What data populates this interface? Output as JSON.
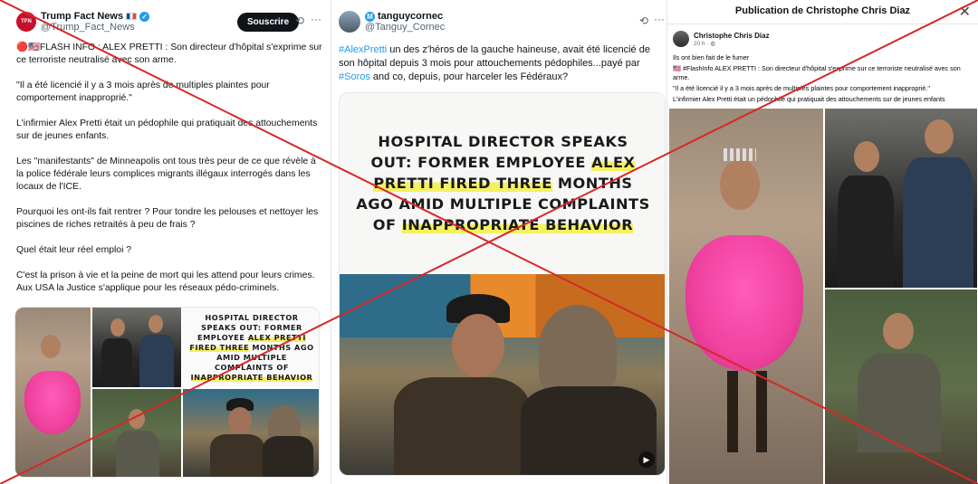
{
  "post1": {
    "account_name": "Trump Fact News",
    "account_handle": "@Trump_Fact_News",
    "avatar_text": "TFN",
    "subscribe_label": "Souscrire",
    "paragraphs": [
      "🔴🇺🇸FLASH INFO : ALEX PRETTI : Son directeur d'hôpital s'exprime sur ce terroriste neutralisé avec son arme.",
      "\"Il a été licencié il y a 3 mois après de multiples plaintes pour comportement inapproprié.\"",
      "L'infirmier Alex Pretti était un pédophile qui pratiquait des attouchements sur de jeunes enfants.",
      "Les \"manifestants\" de Minneapolis ont tous très peur de ce que révèle à la police fédérale leurs complices migrants illégaux interrogés dans les locaux de l'ICE.",
      "Pourquoi les ont-ils fait rentrer ? Pour tondre les pelouses et nettoyer les piscines de riches retraités à peu de frais ?",
      "Quel était leur réel emploi ?",
      "C'est la prison à vie et la peine de mort qui les attend pour leurs crimes. Aux USA la Justice s'applique pour les réseaux pédo-criminels."
    ],
    "headline": {
      "part1": "HOSPITAL DIRECTOR SPEAKS OUT: FORMER EMPLOYEE ",
      "hl1": "ALEX PRETTI FIRED THREE",
      "part2": " MONTHS AGO AMID MULTIPLE COMPLAINTS OF ",
      "hl2": "INAPPROPRIATE BEHAVIOR"
    }
  },
  "post2": {
    "account_name": "tanguycornec",
    "account_handle": "@Tanguy_Cornec",
    "badge": "M",
    "hashtag1": "#AlexPretti",
    "text1": " un des z'héros de la gauche haineuse, avait été licencié de son hôpital depuis 3 mois pour attouchements pédophiles...payé par ",
    "hashtag2": "#Soros",
    "text2": " and co, depuis, pour harceler les Fédéraux?",
    "headline": {
      "part1": "HOSPITAL DIRECTOR SPEAKS OUT: FORMER EMPLOYEE ",
      "hl1": "ALEX",
      "part1b": " ",
      "hl1b": "PRETTI FIRED THREE",
      "part2": " MONTHS AGO AMID MULTIPLE COMPLAINTS OF ",
      "hl2": "INAPPROPRIATE BEHAVIOR"
    }
  },
  "post3": {
    "dialog_title": "Publication de Christophe Chris Diaz",
    "author": "Christophe Chris Diaz",
    "time": "20 h · ",
    "lines": [
      "Ils ont bien fait de le fumer",
      "🇺🇸 #FlashInfo  ALEX PRETTI : Son directeur d'hôpital s'exprime sur ce terroriste neutralisé avec son arme.",
      "\"Il a été licencié il y a 3 mois après de multiples plaintes pour comportement inapproprié.\"",
      "L'infirmier Alex Pretti était un pédophile qui pratiquait des attouchements sur de jeunes enfants"
    ]
  },
  "colors": {
    "cross": "#d62828",
    "link": "#1d9bf0",
    "highlight": "#f5f060",
    "tutu": "#f0419f"
  },
  "icons": [
    "verified-badge-icon",
    "grok-icon",
    "more-icon",
    "close-icon",
    "globe-icon",
    "play-icon"
  ]
}
